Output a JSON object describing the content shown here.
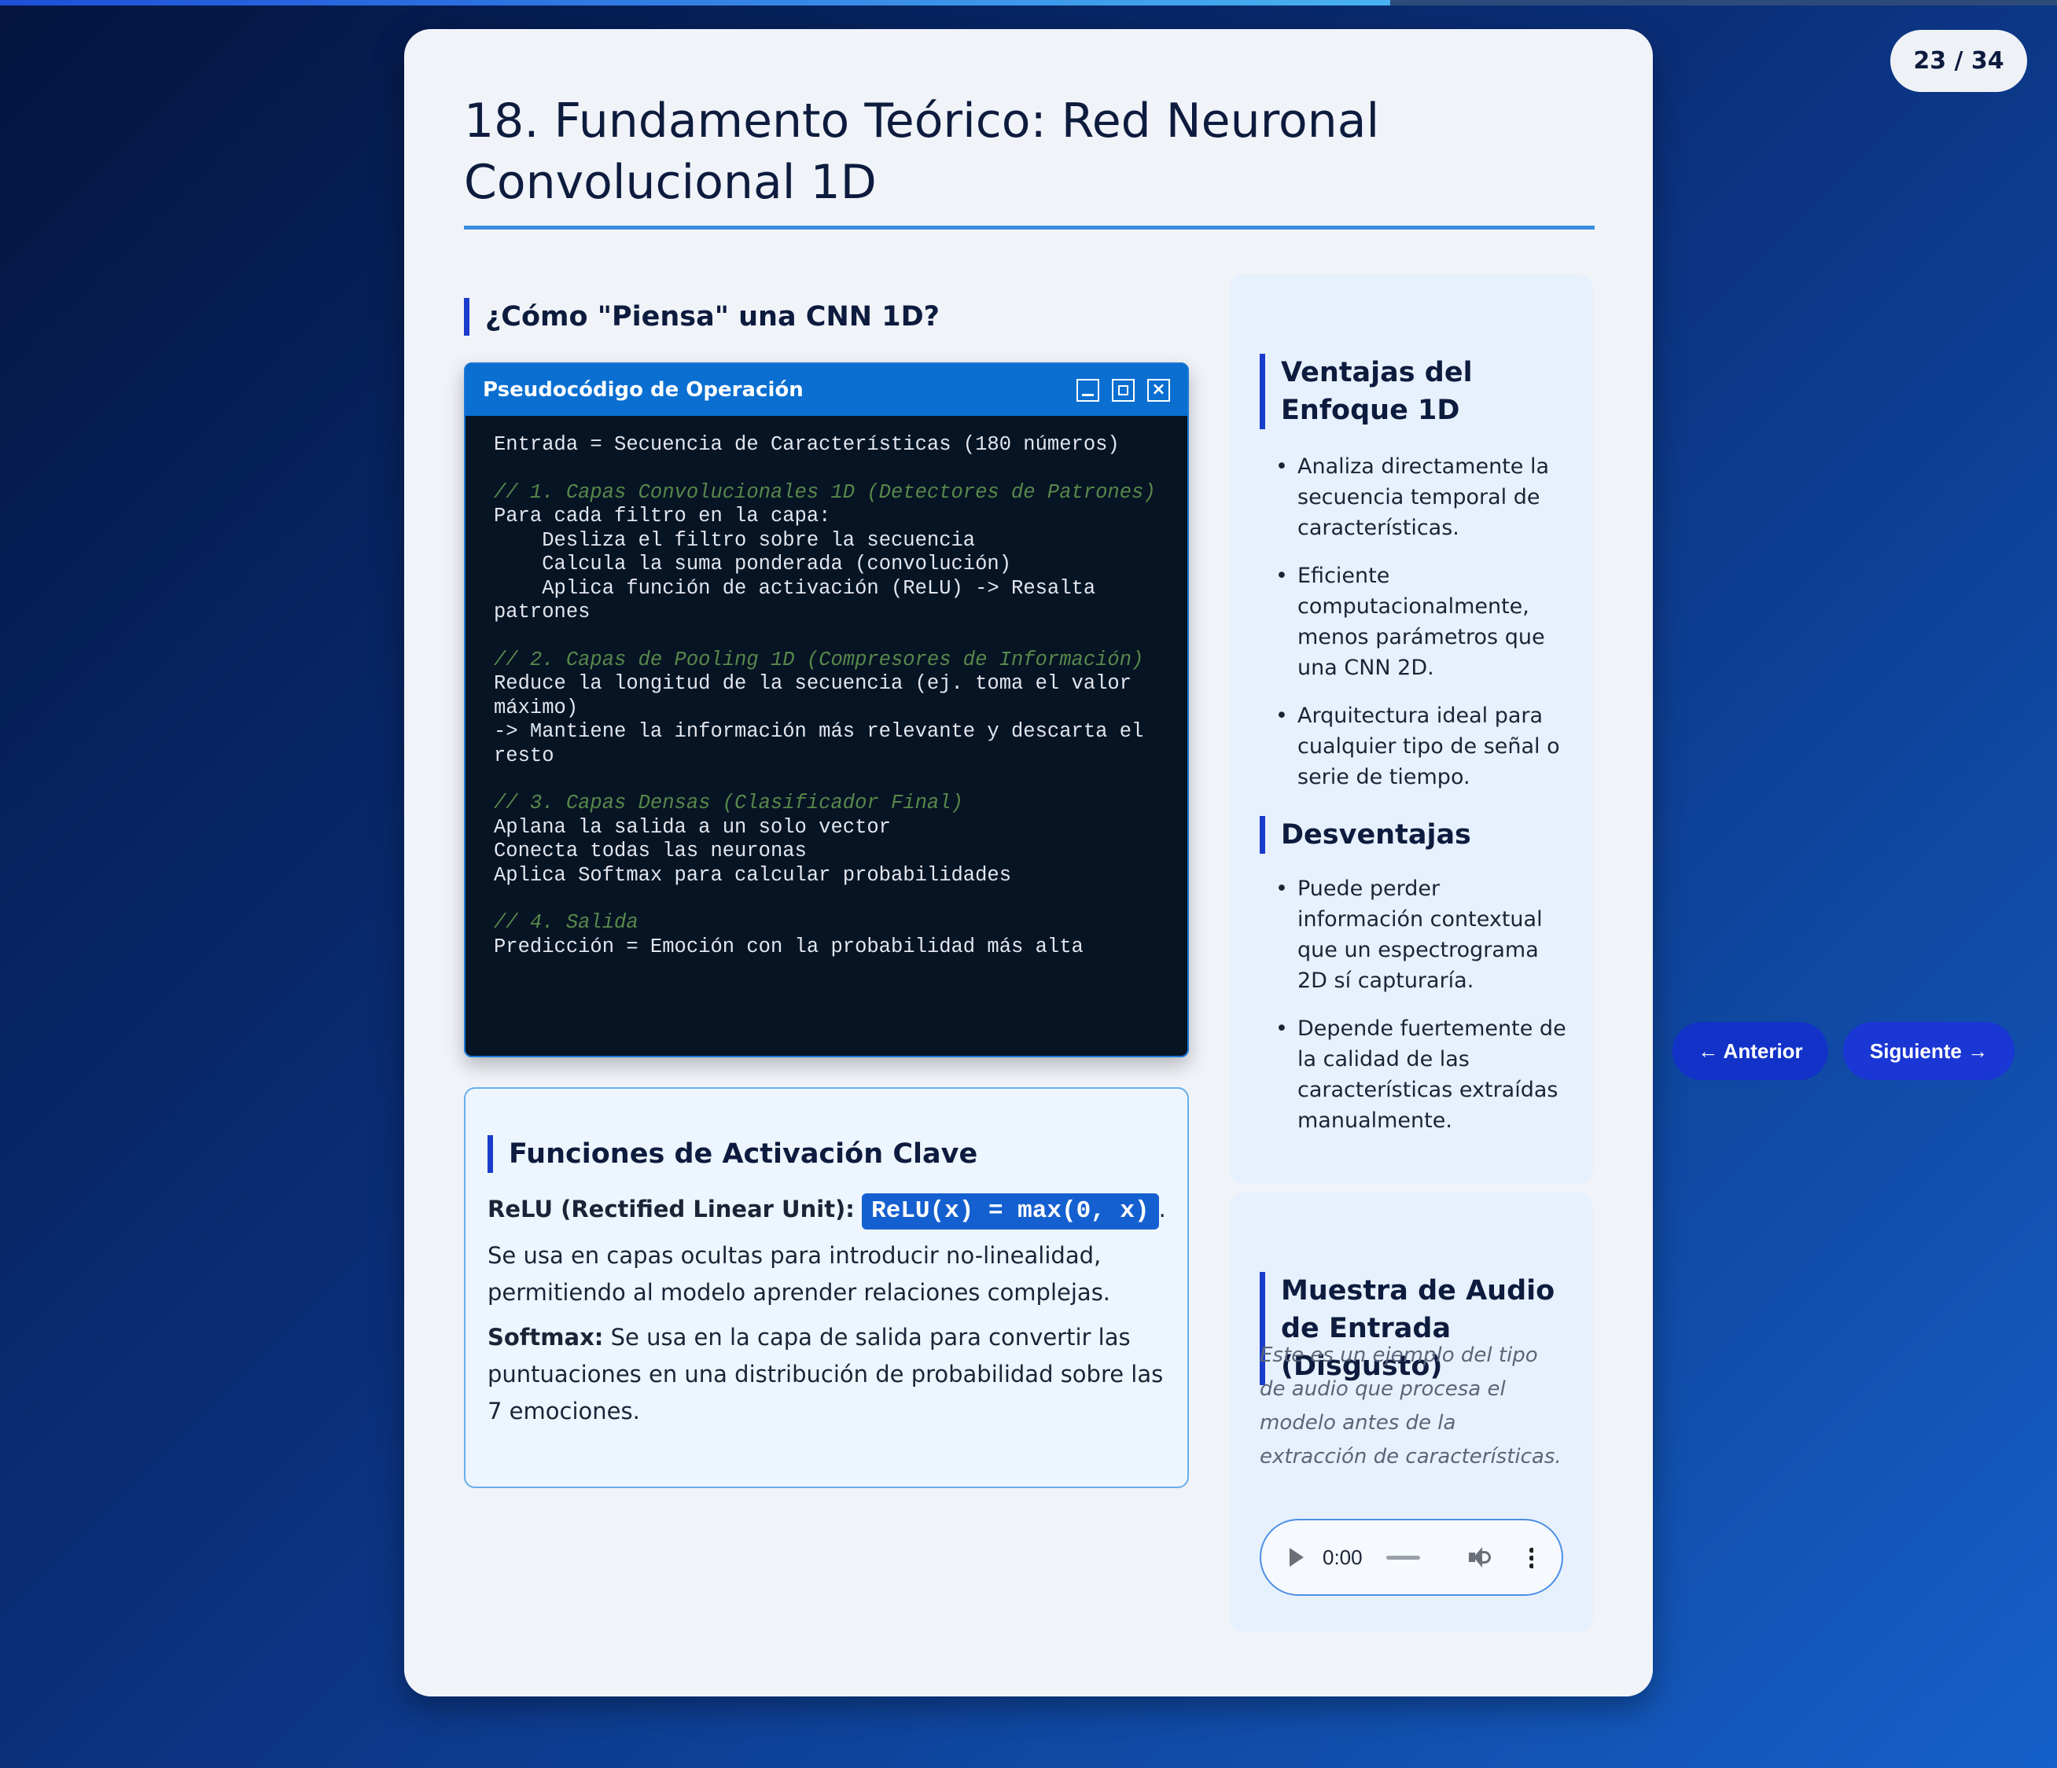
{
  "progress": {
    "current": 23,
    "total": 34,
    "fraction": 0.676
  },
  "counter": "23 / 34",
  "slide": {
    "title": "18. Fundamento Teórico: Red Neuronal Convolucional 1D",
    "section_heading": "¿Cómo \"Piensa\" una CNN 1D?"
  },
  "code_window": {
    "title": "Pseudocódigo de Operación",
    "close_glyph": "×",
    "lines": {
      "l1": "Entrada = Secuencia de Características (180 números)",
      "c1": "// 1. Capas Convolucionales 1D (Detectores de Patrones)",
      "l2": "Para cada filtro en la capa:\n    Desliza el filtro sobre la secuencia\n    Calcula la suma ponderada (convolución)\n    Aplica función de activación (ReLU) -> Resalta patrones",
      "c2": "// 2. Capas de Pooling 1D (Compresores de Información)",
      "l3": "Reduce la longitud de la secuencia (ej. toma el valor máximo)\n-> Mantiene la información más relevante y descarta el resto",
      "c3": "// 3. Capas Densas (Clasificador Final)",
      "l4": "Aplana la salida a un solo vector\nConecta todas las neuronas\nAplica Softmax para calcular probabilidades",
      "c4": "// 4. Salida",
      "l5": "Predicción = Emoción con la probabilidad más alta"
    }
  },
  "activation": {
    "heading": "Funciones de Activación Clave",
    "relu_label": "ReLU (Rectified Linear Unit):",
    "relu_formula": "ReLU(x) = max(0, x)",
    "relu_suffix": ".",
    "relu_desc": "Se usa en capas ocultas para introducir no-linealidad, permitiendo al modelo aprender relaciones complejas.",
    "softmax_label": "Softmax:",
    "softmax_desc": " Se usa en la capa de salida para convertir las puntuaciones en una distribución de probabilidad sobre las 7 emociones."
  },
  "advantages": {
    "heading": "Ventajas del Enfoque 1D",
    "items": [
      "Analiza directamente la secuencia temporal de características.",
      "Eficiente computacionalmente, menos parámetros que una CNN 2D.",
      "Arquitectura ideal para cualquier tipo de señal o serie de tiempo."
    ]
  },
  "disadvantages": {
    "heading": "Desventajas",
    "items": [
      "Puede perder información contextual que un espectrograma 2D sí capturaría.",
      "Depende fuertemente de la calidad de las características extraídas manualmente."
    ]
  },
  "audio_sample": {
    "heading": "Muestra de Audio de Entrada (Disgusto)",
    "note": "Este es un ejemplo del tipo de audio que procesa el modelo antes de la extracción de características.",
    "time": "0:00"
  },
  "nav": {
    "prev_label": "← Anterior",
    "next_label": "Siguiente →"
  },
  "colors": {
    "accent": "#1a3ccc",
    "code_bg": "#061424",
    "window_bar": "#0a6fd1",
    "comment": "#58884a"
  }
}
